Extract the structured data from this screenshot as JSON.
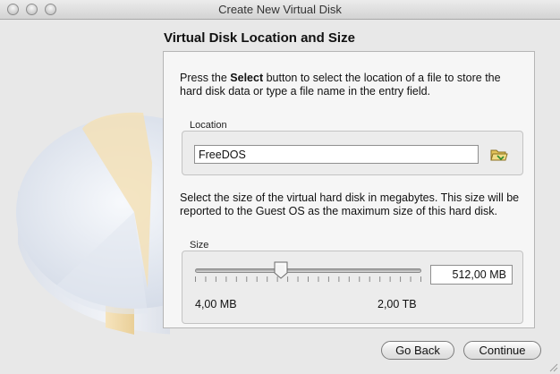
{
  "window": {
    "title": "Create New Virtual Disk"
  },
  "page": {
    "heading": "Virtual Disk Location and Size",
    "location_desc": {
      "before": "Press the ",
      "bold": "Select",
      "after": " button to select the location of a file to store the hard disk data or type a file name in the entry field."
    },
    "location": {
      "label": "Location",
      "value": "FreeDOS",
      "button_icon": "folder-open-icon"
    },
    "size_desc": "Select the size of the virtual hard disk in megabytes. This size will be reported to the Guest OS as the maximum size of this hard disk.",
    "size": {
      "label": "Size",
      "value": "512,00 MB",
      "min_label": "4,00 MB",
      "max_label": "2,00 TB",
      "slider_fraction": 0.38
    }
  },
  "buttons": {
    "back": "Go Back",
    "continue": "Continue"
  },
  "colors": {
    "disk_light": "#eef1f7",
    "disk_shadow": "#b7c1d3",
    "wedge": "#f3dfb6"
  }
}
